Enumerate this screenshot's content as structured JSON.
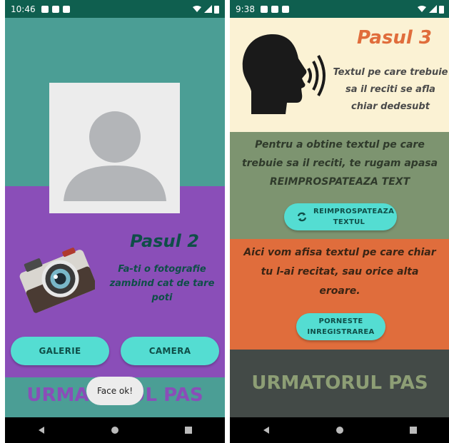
{
  "left_screen": {
    "status_time": "10:46",
    "step_title": "Pasul 2",
    "instruction": "Fa-ti o fotografie zambind cat de tare poti",
    "gallery_button": "GALERIE",
    "camera_button": "CAMERA",
    "next_step": "URMATORUL PAS",
    "toast": "Face ok!",
    "colors": {
      "teal": "#4b9e95",
      "purple": "#8a4eb8",
      "button": "#54ddd2",
      "title": "#0f4e48"
    },
    "icons": [
      "avatar-placeholder-icon",
      "camera-icon"
    ]
  },
  "right_screen": {
    "status_time": "9:38",
    "step_title": "Pasul 3",
    "subtitle": "Textul pe care trebuie sa il reciti se afla chiar dedesubt",
    "prompt": "Pentru a obtine textul pe care trebuie sa il reciti, te rugam apasa REIMPROSPATEAZA TEXT",
    "refresh_button": "REIMPROSPATEAZA TEXTUL",
    "result_text": "Aici vom afisa textul pe care chiar tu l-ai recitat, sau orice alta eroare.",
    "record_button": "PORNESTE INREGISTRAREA",
    "next_step": "URMATORUL PAS",
    "colors": {
      "cream": "#fbf2d4",
      "sage": "#7d9470",
      "orange": "#e06d3c",
      "dark": "#434a47",
      "title": "#e06d3c"
    },
    "icons": [
      "speaking-head-icon",
      "refresh-icon"
    ]
  }
}
